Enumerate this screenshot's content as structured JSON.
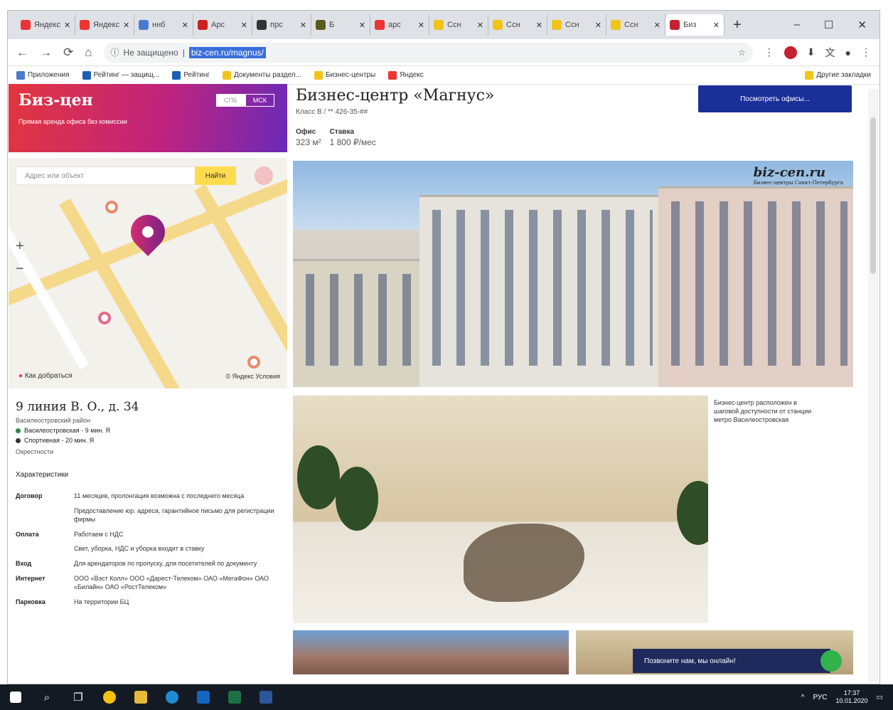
{
  "browser": {
    "tabs": [
      {
        "label": "Яндекс",
        "color": "#e33"
      },
      {
        "label": "Яндекс",
        "color": "#e33"
      },
      {
        "label": "ннб",
        "color": "#4a7bd0"
      },
      {
        "label": "Арс",
        "color": "#c22"
      },
      {
        "label": "прс",
        "color": "#333"
      },
      {
        "label": "Б",
        "color": "#5a5a20"
      },
      {
        "label": "арс",
        "color": "#e33"
      },
      {
        "label": "Ссн",
        "color": "#f0c419"
      },
      {
        "label": "Ссн",
        "color": "#f0c419"
      },
      {
        "label": "Ссн",
        "color": "#f0c419"
      },
      {
        "label": "Ссн",
        "color": "#f0c419"
      },
      {
        "label": "Биз",
        "color": "#c2232f"
      }
    ],
    "new_tab": "+",
    "window_buttons": {
      "minimize": "–",
      "maximize": "☐",
      "close": "✕"
    },
    "address": {
      "security": "Не защищено",
      "url": "biz-cen.ru/magnus/"
    },
    "bookmarks": [
      "Приложения",
      "Рейтинг — защищ...",
      "Рейтинг",
      "Документы раздел...",
      "Бизнес-центры",
      "Яндекс"
    ],
    "other_bookmarks": "Другие закладки"
  },
  "brand": {
    "logo": "Биз-цен",
    "tagline": "Прямая аренда офиса без комиссии",
    "city_spb": "СПБ",
    "city_msk": "МСК"
  },
  "map": {
    "search_placeholder": "Адрес или объект",
    "search_button": "Найти",
    "how_to_get": "Как добраться",
    "yandex_credit": "© Яндекс Условия"
  },
  "listing": {
    "title": "Бизнес-центр «Магнус»",
    "klass": "Класс B / ** 426-35-##",
    "area_label": "Офис",
    "area_value": "323 м²",
    "rate_label": "Ставка",
    "rate_value": "1 800 ₽/мес",
    "view_button": "Посмотреть офисы...",
    "watermark": "biz-cen.ru",
    "watermark_sub": "Бизнес-центры Санкт-Петербурга",
    "caption": "Бизнес-центр расположен в шаговой доступности от станции метро Василеостровская"
  },
  "address": {
    "line": "9 линия В. О., д. 34",
    "district": "Василеостровский район",
    "metro": [
      {
        "name": "Василеостровская - 9 мин. Я",
        "color": "#2f8a3a"
      },
      {
        "name": "Спортивная - 20 мин. Я",
        "color": "#333333"
      }
    ],
    "near": "Окрестности",
    "chars_title": "Характеристики",
    "rows": [
      {
        "k": "Договор",
        "v": "11 месяцев, пролонгация возможна с последнего месяца"
      },
      {
        "k": "",
        "v": "Предоставление юр. адреса, гарантийное письмо для регистрации фирмы"
      },
      {
        "k": "Оплата",
        "v": "Работаем с НДС"
      },
      {
        "k": "",
        "v": "Свет, уборка, НДС и уборка входит в ставку"
      },
      {
        "k": "Вход",
        "v": "Для арендаторов по пропуску, для посетителей по документу"
      },
      {
        "k": "Интернет",
        "v": "ООО «Вэст Колл» ООО «Дарест-Телеком» ОАО «МегаФон» ОАО «Билайн» ОАО «РостТелеком»"
      },
      {
        "k": "Парковка",
        "v": "На территории БЦ"
      }
    ]
  },
  "chat": {
    "label": "Позвоните нам, мы онлайн!"
  },
  "taskbar": {
    "lang": "РУС",
    "time": "17:37",
    "date": "10.01.2020"
  }
}
